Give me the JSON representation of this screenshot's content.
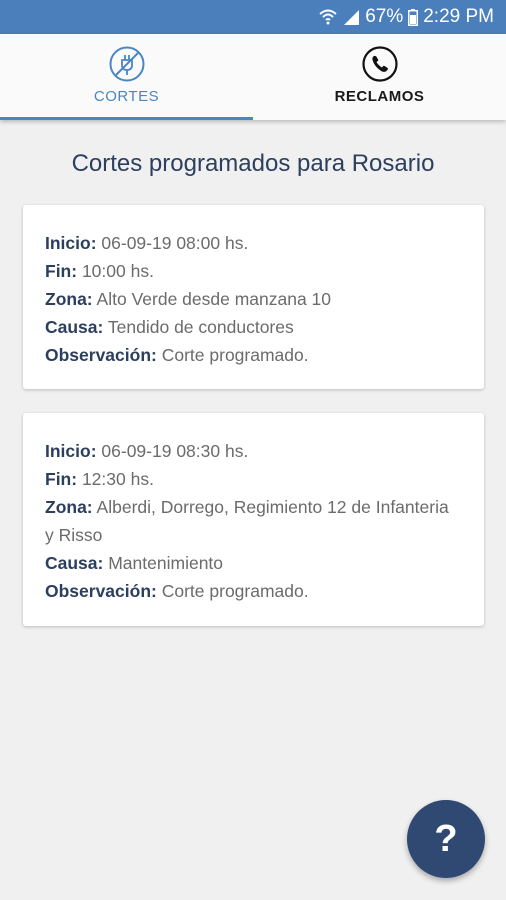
{
  "status_bar": {
    "battery_percent": "67%",
    "time": "2:29 PM"
  },
  "tabs": [
    {
      "label": "CORTES",
      "selected": true,
      "icon": "no-plug-icon"
    },
    {
      "label": "RECLAMOS",
      "selected": false,
      "icon": "phone-icon"
    }
  ],
  "page_title": "Cortes programados para Rosario",
  "cards": [
    {
      "inicio_label": "Inicio:",
      "inicio": "06-09-19 08:00 hs.",
      "fin_label": "Fin:",
      "fin": "10:00 hs.",
      "zona_label": "Zona:",
      "zona": "Alto Verde desde manzana 10",
      "causa_label": "Causa:",
      "causa": "Tendido de conductores",
      "obs_label": "Observación:",
      "obs": "Corte programado."
    },
    {
      "inicio_label": "Inicio:",
      "inicio": "06-09-19 08:30 hs.",
      "fin_label": "Fin:",
      "fin": "12:30 hs.",
      "zona_label": "Zona:",
      "zona": "Alberdi, Dorrego, Regimiento 12 de Infanteria y Risso",
      "causa_label": "Causa:",
      "causa": "Mantenimiento",
      "obs_label": "Observación:",
      "obs": "Corte programado."
    }
  ],
  "fab": {
    "label": "?",
    "icon": "help-icon"
  },
  "colors": {
    "status_bar": "#4a7fbc",
    "accent": "#4a86c5",
    "heading": "#2d3f5e",
    "fab": "#2f4972",
    "background": "#f0f0f0"
  }
}
